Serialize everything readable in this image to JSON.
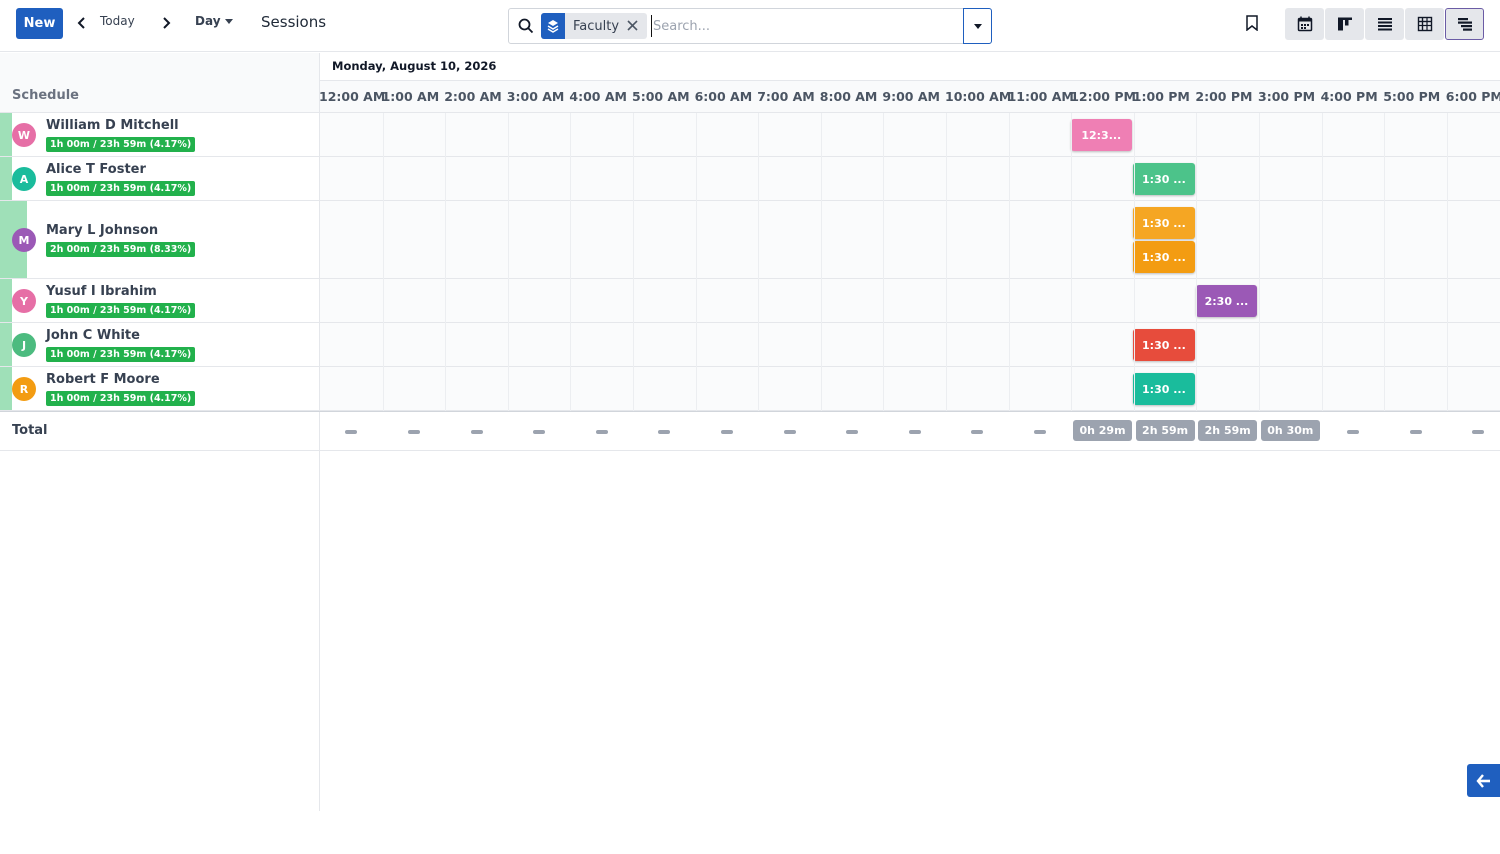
{
  "toolbar": {
    "new_label": "New",
    "today_label": "Today",
    "scale_label": "Day",
    "title": "Sessions"
  },
  "search": {
    "facet_label": "Faculty",
    "placeholder": "Search..."
  },
  "gantt": {
    "schedule_header": "Schedule",
    "date_label": "Monday, August 10, 2026",
    "hours": [
      "12:00 AM",
      "1:00 AM",
      "2:00 AM",
      "3:00 AM",
      "4:00 AM",
      "5:00 AM",
      "6:00 AM",
      "7:00 AM",
      "8:00 AM",
      "9:00 AM",
      "10:00 AM",
      "11:00 AM",
      "12:00 PM",
      "1:00 PM",
      "2:00 PM",
      "3:00 PM",
      "4:00 PM",
      "5:00 PM",
      "6:00 PM"
    ],
    "rows": [
      {
        "initial": "W",
        "name": "William D Mitchell",
        "allocation": "1h 00m / 23h 59m (4.17%)",
        "avatar_color": "#e66fa6",
        "pills": [
          {
            "label": "12:3...",
            "color": "#ef7fb4"
          }
        ]
      },
      {
        "initial": "A",
        "name": "Alice T Foster",
        "allocation": "1h 00m / 23h 59m (4.17%)",
        "avatar_color": "#1abc9c",
        "pills": [
          {
            "label": "1:30 ...",
            "color": "#4cc38a"
          }
        ]
      },
      {
        "initial": "M",
        "name": "Mary L Johnson",
        "allocation": "2h 00m / 23h 59m (8.33%)",
        "avatar_color": "#9b59b6",
        "pills": [
          {
            "label": "1:30 ...",
            "color": "#f5a623"
          },
          {
            "label": "1:30 ...",
            "color": "#f39c12"
          }
        ]
      },
      {
        "initial": "Y",
        "name": "Yusuf I Ibrahim",
        "allocation": "1h 00m / 23h 59m (4.17%)",
        "avatar_color": "#e66fa6",
        "pills": [
          {
            "label": "2:30 ...",
            "color": "#9b59b6"
          }
        ]
      },
      {
        "initial": "J",
        "name": "John C White",
        "allocation": "1h 00m / 23h 59m (4.17%)",
        "avatar_color": "#4cbb7f",
        "pills": [
          {
            "label": "1:30 ...",
            "color": "#e74c3c"
          }
        ]
      },
      {
        "initial": "R",
        "name": "Robert F Moore",
        "allocation": "1h 00m / 23h 59m (4.17%)",
        "avatar_color": "#f39c12",
        "pills": [
          {
            "label": "1:30 ...",
            "color": "#1abc9c"
          }
        ]
      }
    ],
    "total_label": "Total",
    "totals": {
      "12:00 PM": "0h 29m",
      "1:00 PM": "2h 59m",
      "2:00 PM": "2h 59m",
      "3:00 PM": "0h 30m"
    }
  },
  "icons": {
    "prev": "chevron-left-icon",
    "next": "chevron-right-icon",
    "search": "search-icon",
    "facet": "layers-icon",
    "bookmark": "bookmark-icon",
    "views": [
      "calendar-icon",
      "kanban-icon",
      "list-icon",
      "pivot-icon",
      "gantt-icon"
    ]
  },
  "colors": {
    "primary": "#1f5fbf",
    "allocation_badge": "#22b14c",
    "total_badge": "#9ca3af"
  }
}
